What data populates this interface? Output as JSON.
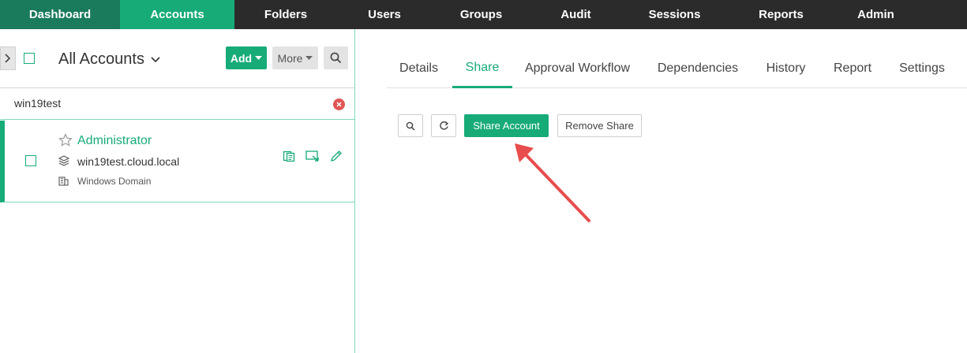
{
  "nav": {
    "items": [
      {
        "label": "Dashboard"
      },
      {
        "label": "Accounts"
      },
      {
        "label": "Folders"
      },
      {
        "label": "Users"
      },
      {
        "label": "Groups"
      },
      {
        "label": "Audit"
      },
      {
        "label": "Sessions"
      },
      {
        "label": "Reports"
      },
      {
        "label": "Admin"
      }
    ],
    "active": "Accounts"
  },
  "left": {
    "title": "All Accounts",
    "add_label": "Add",
    "more_label": "More",
    "filter_value": "win19test",
    "account": {
      "name": "Administrator",
      "host": "win19test.cloud.local",
      "type": "Windows Domain"
    }
  },
  "tabs": [
    {
      "label": "Details"
    },
    {
      "label": "Share"
    },
    {
      "label": "Approval Workflow"
    },
    {
      "label": "Dependencies"
    },
    {
      "label": "History"
    },
    {
      "label": "Report"
    },
    {
      "label": "Settings"
    }
  ],
  "active_tab": "Share",
  "share": {
    "share_account_label": "Share Account",
    "remove_share_label": "Remove Share"
  },
  "colors": {
    "accent": "#17ab78",
    "nav_bg": "#2b2b2b",
    "annotation_arrow": "#e84c4c"
  }
}
